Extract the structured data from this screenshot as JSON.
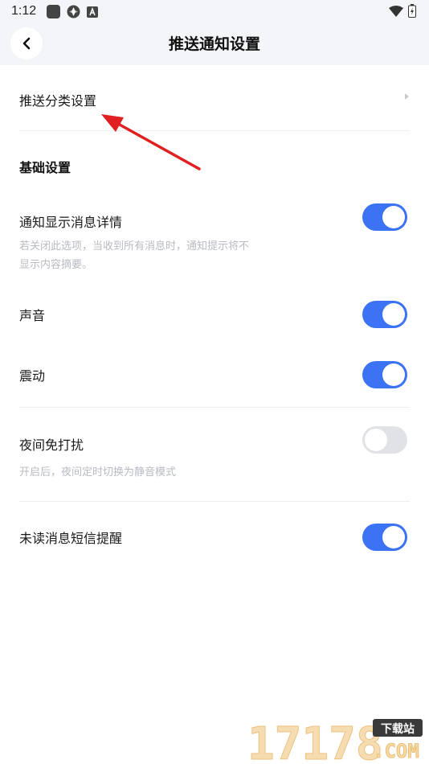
{
  "status": {
    "time": "1:12"
  },
  "header": {
    "title": "推送通知设置"
  },
  "push_category": {
    "label": "推送分类设置"
  },
  "basic": {
    "section_title": "基础设置",
    "notify_detail": {
      "label": "通知显示消息详情",
      "desc": "若关闭此选项，当收到所有消息时，通知提示将不显示内容摘要。",
      "on": true
    },
    "sound": {
      "label": "声音",
      "on": true
    },
    "vibrate": {
      "label": "震动",
      "on": true
    }
  },
  "night": {
    "label": "夜间免打扰",
    "desc": "开启后，夜间定时切换为静音模式",
    "on": false
  },
  "sms": {
    "label": "未读消息短信提醒",
    "on": true
  },
  "watermark": {
    "digits": "17178",
    "tag": "下载站",
    "domain": ".COM"
  },
  "colors": {
    "accent": "#3b73f4",
    "toggle_off": "#e1e2e6",
    "annotation": "#e02020"
  }
}
